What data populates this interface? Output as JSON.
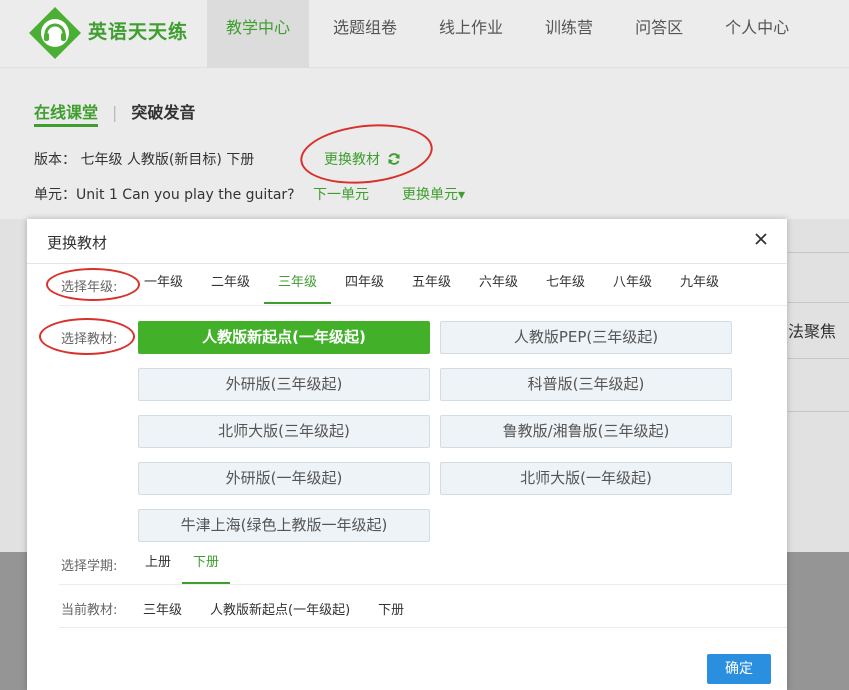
{
  "app": {
    "name": "英语天天练",
    "brand_color": "#3e9e2e"
  },
  "nav": {
    "items": [
      {
        "label": "教学中心",
        "active": true
      },
      {
        "label": "选题组卷",
        "active": false
      },
      {
        "label": "线上作业",
        "active": false
      },
      {
        "label": "训练营",
        "active": false
      },
      {
        "label": "问答区",
        "active": false
      },
      {
        "label": "个人中心",
        "active": false
      }
    ]
  },
  "page": {
    "tabs": {
      "active": "在线课堂",
      "other": "突破发音"
    },
    "edition_line": "版本： 七年级 人教版(新目标) 下册",
    "change_book": "更换教材",
    "unit_line": "单元：Unit 1 Can you play the guitar?",
    "next_unit": "下一单元",
    "change_unit": "更换单元▾",
    "right_text": "法聚焦"
  },
  "modal": {
    "title": "更换教材",
    "grade_label": "选择年级:",
    "grades": [
      {
        "label": "一年级",
        "active": false
      },
      {
        "label": "二年级",
        "active": false
      },
      {
        "label": "三年级",
        "active": true
      },
      {
        "label": "四年级",
        "active": false
      },
      {
        "label": "五年级",
        "active": false
      },
      {
        "label": "六年级",
        "active": false
      },
      {
        "label": "七年级",
        "active": false
      },
      {
        "label": "八年级",
        "active": false
      },
      {
        "label": "九年级",
        "active": false
      }
    ],
    "book_label": "选择教材:",
    "books": [
      {
        "label": "人教版新起点(一年级起)",
        "active": true
      },
      {
        "label": "人教版PEP(三年级起)",
        "active": false
      },
      {
        "label": "外研版(三年级起)",
        "active": false
      },
      {
        "label": "科普版(三年级起)",
        "active": false
      },
      {
        "label": "北师大版(三年级起)",
        "active": false
      },
      {
        "label": "鲁教版/湘鲁版(三年级起)",
        "active": false
      },
      {
        "label": "外研版(一年级起)",
        "active": false
      },
      {
        "label": "北师大版(一年级起)",
        "active": false
      },
      {
        "label": "牛津上海(绿色上教版一年级起)",
        "active": false
      }
    ],
    "term_label": "选择学期:",
    "terms": [
      {
        "label": "上册",
        "active": false
      },
      {
        "label": "下册",
        "active": true
      }
    ],
    "current_label": "当前教材:",
    "current": {
      "grade": "三年级",
      "book": "人教版新起点(一年级起)",
      "term": "下册"
    },
    "confirm": "确定"
  },
  "colors": {
    "active_green": "#43b02a",
    "confirm_blue": "#2b8fe0",
    "annotation_red": "#d9302b"
  }
}
